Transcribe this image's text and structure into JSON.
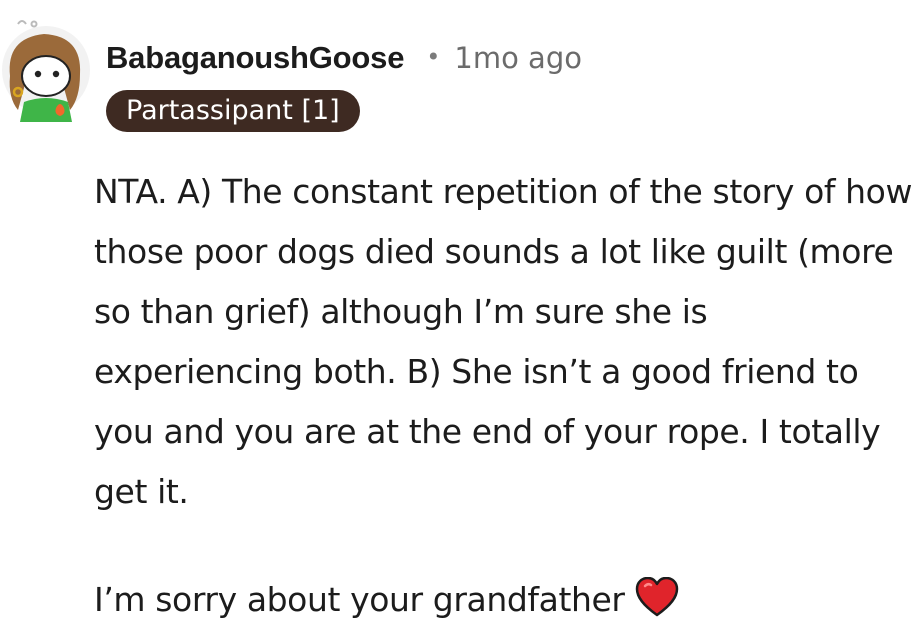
{
  "comment": {
    "username": "BabaganoushGoose",
    "separator": "•",
    "timestamp": "1mo ago",
    "flair": "Partassipant [1]",
    "paragraphs": [
      "NTA. A) The constant repetition of the story of how those poor dogs died sounds a lot like guilt (more so than grief) although I’m sure she is experiencing both. B) She isn’t a good friend to you and you are at the end of your rope. I totally get it.",
      "I’m sorry about your grandfather"
    ],
    "emoji": "heart-emoji"
  },
  "colors": {
    "flair_background": "#3e2a22",
    "heart": "#e0242b",
    "muted_text": "#6b6b6b"
  }
}
